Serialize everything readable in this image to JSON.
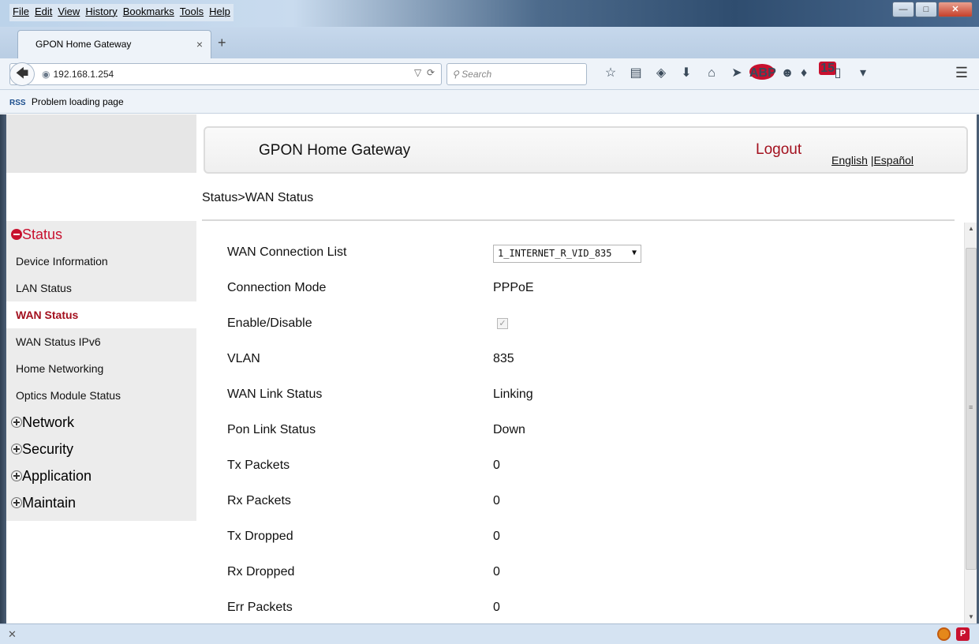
{
  "browser": {
    "menu": [
      "File",
      "Edit",
      "View",
      "History",
      "Bookmarks",
      "Tools",
      "Help"
    ],
    "tab_title": "GPON Home Gateway",
    "tab_close": "×",
    "new_tab": "+",
    "url": "192.168.1.254",
    "search_placeholder": "Search",
    "bookmark_item": "Problem loading page",
    "bookmark_icon_text": "RSS",
    "toolbar_badge": "15",
    "abp_label": "ABP"
  },
  "header": {
    "title": "GPON Home Gateway",
    "logout": "Logout",
    "lang_english": "English",
    "lang_sep": " |",
    "lang_spanish": "Español"
  },
  "breadcrumb": "Status>WAN Status",
  "sidebar": {
    "sections": [
      {
        "label": "Status",
        "expanded": true
      },
      {
        "label": "Network",
        "expanded": false
      },
      {
        "label": "Security",
        "expanded": false
      },
      {
        "label": "Application",
        "expanded": false
      },
      {
        "label": "Maintain",
        "expanded": false
      }
    ],
    "status_items": [
      "Device Information",
      "LAN Status",
      "WAN Status",
      "WAN Status IPv6",
      "Home Networking",
      "Optics Module Status"
    ],
    "active_item": "WAN Status"
  },
  "wan": {
    "connection_list_label": "WAN Connection List",
    "connection_list_value": "1_INTERNET_R_VID_835",
    "connection_mode_label": "Connection Mode",
    "connection_mode_value": "PPPoE",
    "enable_label": "Enable/Disable",
    "enable_checked": true,
    "vlan_label": "VLAN",
    "vlan_value": "835",
    "link_status_label": "WAN Link Status",
    "link_status_value": "Linking",
    "pon_label": "Pon Link Status",
    "pon_value": "Down",
    "tx_packets_label": "Tx Packets",
    "tx_packets_value": "0",
    "rx_packets_label": "Rx Packets",
    "rx_packets_value": "0",
    "tx_dropped_label": "Tx Dropped",
    "tx_dropped_value": "0",
    "rx_dropped_label": "Rx Dropped",
    "rx_dropped_value": "0",
    "err_packets_label": "Err Packets",
    "err_packets_value": "0"
  },
  "colors": {
    "accent_red": "#a3101e",
    "status_icon_red": "#c8102e"
  },
  "icons": {
    "back": "back-arrow-icon",
    "star": "bookmark-star-icon",
    "reading_list": "reading-list-icon",
    "pocket": "pocket-icon",
    "download": "download-icon",
    "home": "home-icon",
    "send": "send-icon",
    "chat": "chat-icon",
    "menu": "hamburger-menu-icon"
  }
}
